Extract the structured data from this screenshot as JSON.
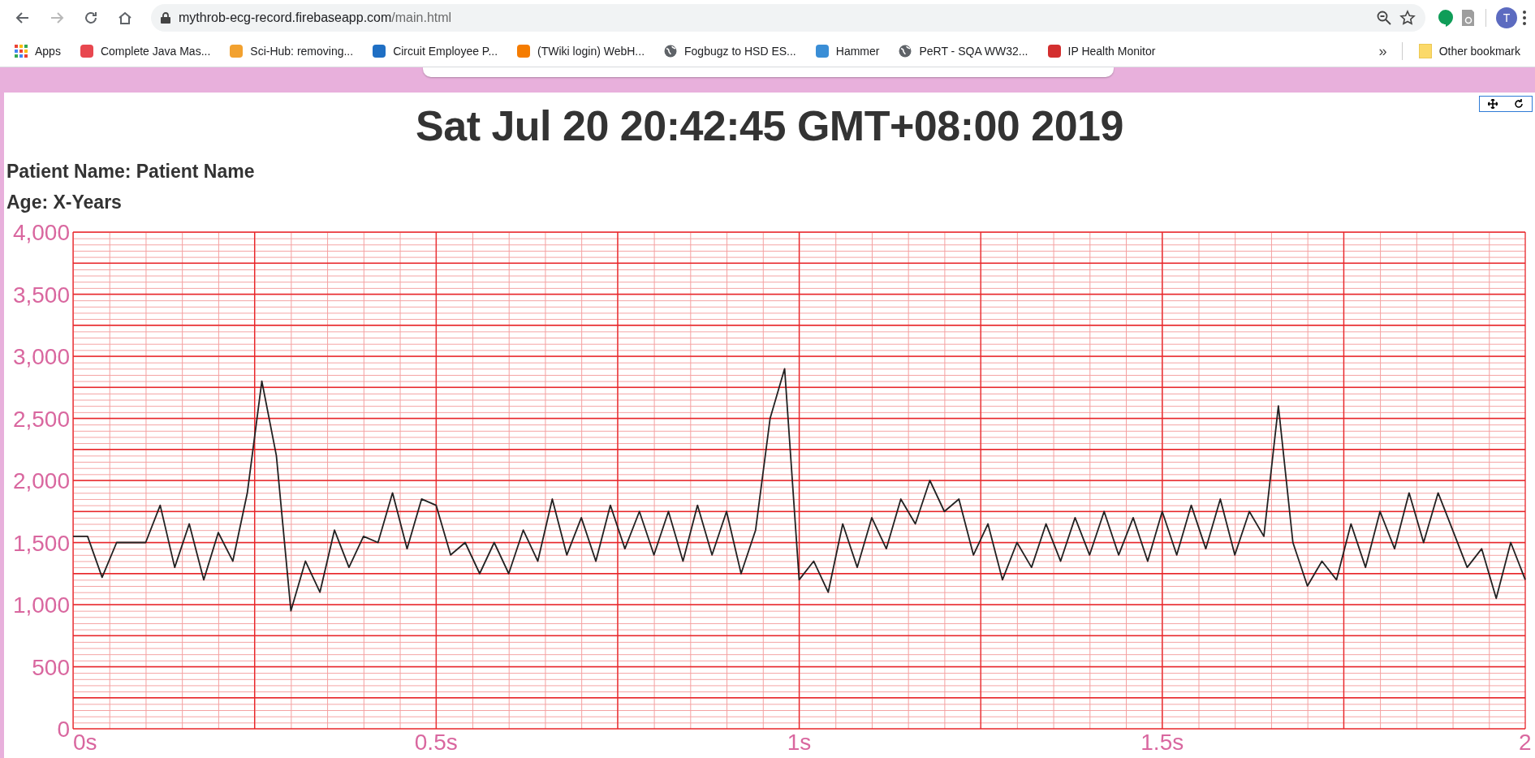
{
  "browser": {
    "url_host": "mythrob-ecg-record.firebaseapp.com",
    "url_path": "/main.html",
    "avatar": "T",
    "bookmarks": [
      {
        "label": "Apps",
        "kind": "grid"
      },
      {
        "label": "Complete Java Mas...",
        "kind": "badge",
        "color": "#e8474f"
      },
      {
        "label": "Sci-Hub: removing...",
        "kind": "badge",
        "color": "#f2a12f"
      },
      {
        "label": "Circuit Employee P...",
        "kind": "badge",
        "color": "#1f6fc4"
      },
      {
        "label": "(TWiki login) WebH...",
        "kind": "badge",
        "color": "#f57c00"
      },
      {
        "label": "Fogbugz to HSD ES...",
        "kind": "globe"
      },
      {
        "label": "Hammer",
        "kind": "badge",
        "color": "#3a8ed6"
      },
      {
        "label": "PeRT - SQA WW32...",
        "kind": "globe"
      },
      {
        "label": "IP Health Monitor",
        "kind": "badge",
        "color": "#d32f2f"
      }
    ],
    "overflow": "»",
    "other_bookmarks": "Other bookmark"
  },
  "page": {
    "title": "Sat Jul 20 20:42:45 GMT+08:00 2019",
    "patient_name": "Patient Name: Patient Name",
    "age": "Age: X-Years",
    "chart_data": {
      "type": "line",
      "grid": true,
      "xlim": [
        0,
        2
      ],
      "ylim": [
        0,
        4000
      ],
      "xticks": [
        {
          "value": 0,
          "label": "0s"
        },
        {
          "value": 0.5,
          "label": "0.5s"
        },
        {
          "value": 1,
          "label": "1s"
        },
        {
          "value": 1.5,
          "label": "1.5s"
        },
        {
          "value": 2,
          "label": "2"
        }
      ],
      "yticks": [
        {
          "value": 0,
          "label": "0"
        },
        {
          "value": 500,
          "label": "500"
        },
        {
          "value": 1000,
          "label": "1,000"
        },
        {
          "value": 1500,
          "label": "1,500"
        },
        {
          "value": 2000,
          "label": "2,000"
        },
        {
          "value": 2500,
          "label": "2,500"
        },
        {
          "value": 3000,
          "label": "3,000"
        },
        {
          "value": 3500,
          "label": "3,500"
        },
        {
          "value": 4000,
          "label": "4,000"
        }
      ],
      "x": [
        0,
        0.02,
        0.04,
        0.06,
        0.08,
        0.1,
        0.12,
        0.14,
        0.16,
        0.18,
        0.2,
        0.22,
        0.24,
        0.26,
        0.28,
        0.3,
        0.32,
        0.34,
        0.36,
        0.38,
        0.4,
        0.42,
        0.44,
        0.46,
        0.48,
        0.5,
        0.52,
        0.54,
        0.56,
        0.58,
        0.6,
        0.62,
        0.64,
        0.66,
        0.68,
        0.7,
        0.72,
        0.74,
        0.76,
        0.78,
        0.8,
        0.82,
        0.84,
        0.86,
        0.88,
        0.9,
        0.92,
        0.94,
        0.96,
        0.98,
        1,
        1.02,
        1.04,
        1.06,
        1.08,
        1.1,
        1.12,
        1.14,
        1.16,
        1.18,
        1.2,
        1.22,
        1.24,
        1.26,
        1.28,
        1.3,
        1.32,
        1.34,
        1.36,
        1.38,
        1.4,
        1.42,
        1.44,
        1.46,
        1.48,
        1.5,
        1.52,
        1.54,
        1.56,
        1.58,
        1.6,
        1.62,
        1.64,
        1.66,
        1.68,
        1.7,
        1.72,
        1.74,
        1.76,
        1.78,
        1.8,
        1.82,
        1.84,
        1.86,
        1.88,
        1.9,
        1.92,
        1.94,
        1.96,
        1.98,
        2
      ],
      "series": [
        {
          "color": "#222222",
          "values": [
            1550,
            1550,
            1220,
            1500,
            1500,
            1500,
            1800,
            1300,
            1650,
            1200,
            1580,
            1350,
            1900,
            2800,
            2200,
            950,
            1350,
            1100,
            1600,
            1300,
            1550,
            1500,
            1900,
            1450,
            1850,
            1800,
            1400,
            1500,
            1250,
            1500,
            1250,
            1600,
            1350,
            1850,
            1400,
            1700,
            1350,
            1800,
            1450,
            1750,
            1400,
            1750,
            1350,
            1800,
            1400,
            1750,
            1250,
            1600,
            2500,
            2900,
            1200,
            1350,
            1100,
            1650,
            1300,
            1700,
            1450,
            1850,
            1650,
            2000,
            1750,
            1850,
            1400,
            1650,
            1200,
            1500,
            1300,
            1650,
            1350,
            1700,
            1400,
            1750,
            1400,
            1700,
            1350,
            1750,
            1400,
            1800,
            1450,
            1850,
            1400,
            1750,
            1550,
            2600,
            1500,
            1150,
            1350,
            1200,
            1650,
            1300,
            1750,
            1450,
            1900,
            1500,
            1900,
            1600,
            1300,
            1450,
            1050,
            1500,
            1200
          ]
        }
      ]
    }
  }
}
